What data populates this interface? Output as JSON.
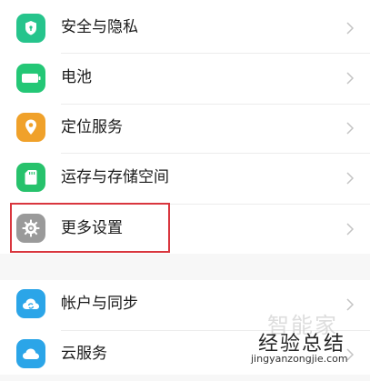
{
  "settings": {
    "items": [
      {
        "label": "安全与隐私",
        "icon": "shield-icon",
        "color": "#26c48c"
      },
      {
        "label": "电池",
        "icon": "battery-icon",
        "color": "#24c776"
      },
      {
        "label": "定位服务",
        "icon": "location-pin-icon",
        "color": "#f0a12a"
      },
      {
        "label": "运存与存储空间",
        "icon": "sd-card-icon",
        "color": "#27c26c"
      },
      {
        "label": "更多设置",
        "icon": "gear-icon",
        "color": "#9a9a9a"
      }
    ],
    "items2": [
      {
        "label": "帐户与同步",
        "icon": "cloud-sync-icon",
        "color": "#2ba5e8"
      },
      {
        "label": "云服务",
        "icon": "cloud-icon",
        "color": "#2ba5e8"
      }
    ]
  },
  "highlight": {
    "color": "#d9363e"
  },
  "watermark": {
    "ghost": "智能家",
    "line1": "经验总结",
    "line2": "jingyanzongjie.com"
  }
}
